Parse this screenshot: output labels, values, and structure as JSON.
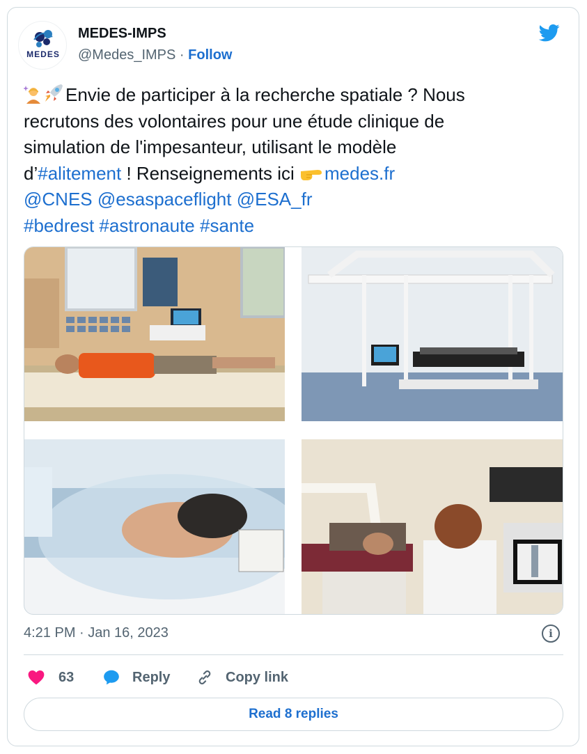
{
  "author": {
    "name": "MEDES-IMPS",
    "handle": "@Medes_IMPS",
    "separator": "·",
    "follow_label": "Follow",
    "avatar_text": "MEDES"
  },
  "tweet": {
    "line1": "Envie de participer à la recherche spatiale ? Nous",
    "line2": "recrutons des volontaires pour une étude clinique de",
    "line3": "simulation de l'impesanteur, utilisant le modèle",
    "line4_prefix": "d’",
    "hashtag_alitement": "#alitement",
    "line4_middle": " ! Renseignements ici ",
    "link_medes": "medes.fr",
    "mention_cnes": "@CNES",
    "mention_esa_spaceflight": "@esaspaceflight",
    "mention_esa_fr": "@ESA_fr",
    "hashtag_bedrest": "#bedrest",
    "hashtag_astronaute": "#astronaute",
    "hashtag_sante": "#sante"
  },
  "timestamp": "4:21 PM · Jan 16, 2023",
  "info_glyph": "i",
  "actions": {
    "like_count": "63",
    "reply_label": "Reply",
    "copy_link_label": "Copy link"
  },
  "read_replies_label": "Read 8 replies",
  "colors": {
    "link": "#1d6fcf",
    "twitter_blue": "#1d9bf0",
    "heart": "#f91880",
    "muted": "#536471",
    "border": "#cfd9de"
  },
  "icons": [
    "twitter-bird-icon",
    "sparkle-person-emoji-icon",
    "rocket-emoji-icon",
    "pointing-hand-emoji-icon",
    "info-icon",
    "heart-icon",
    "speech-bubble-icon",
    "link-icon"
  ]
}
